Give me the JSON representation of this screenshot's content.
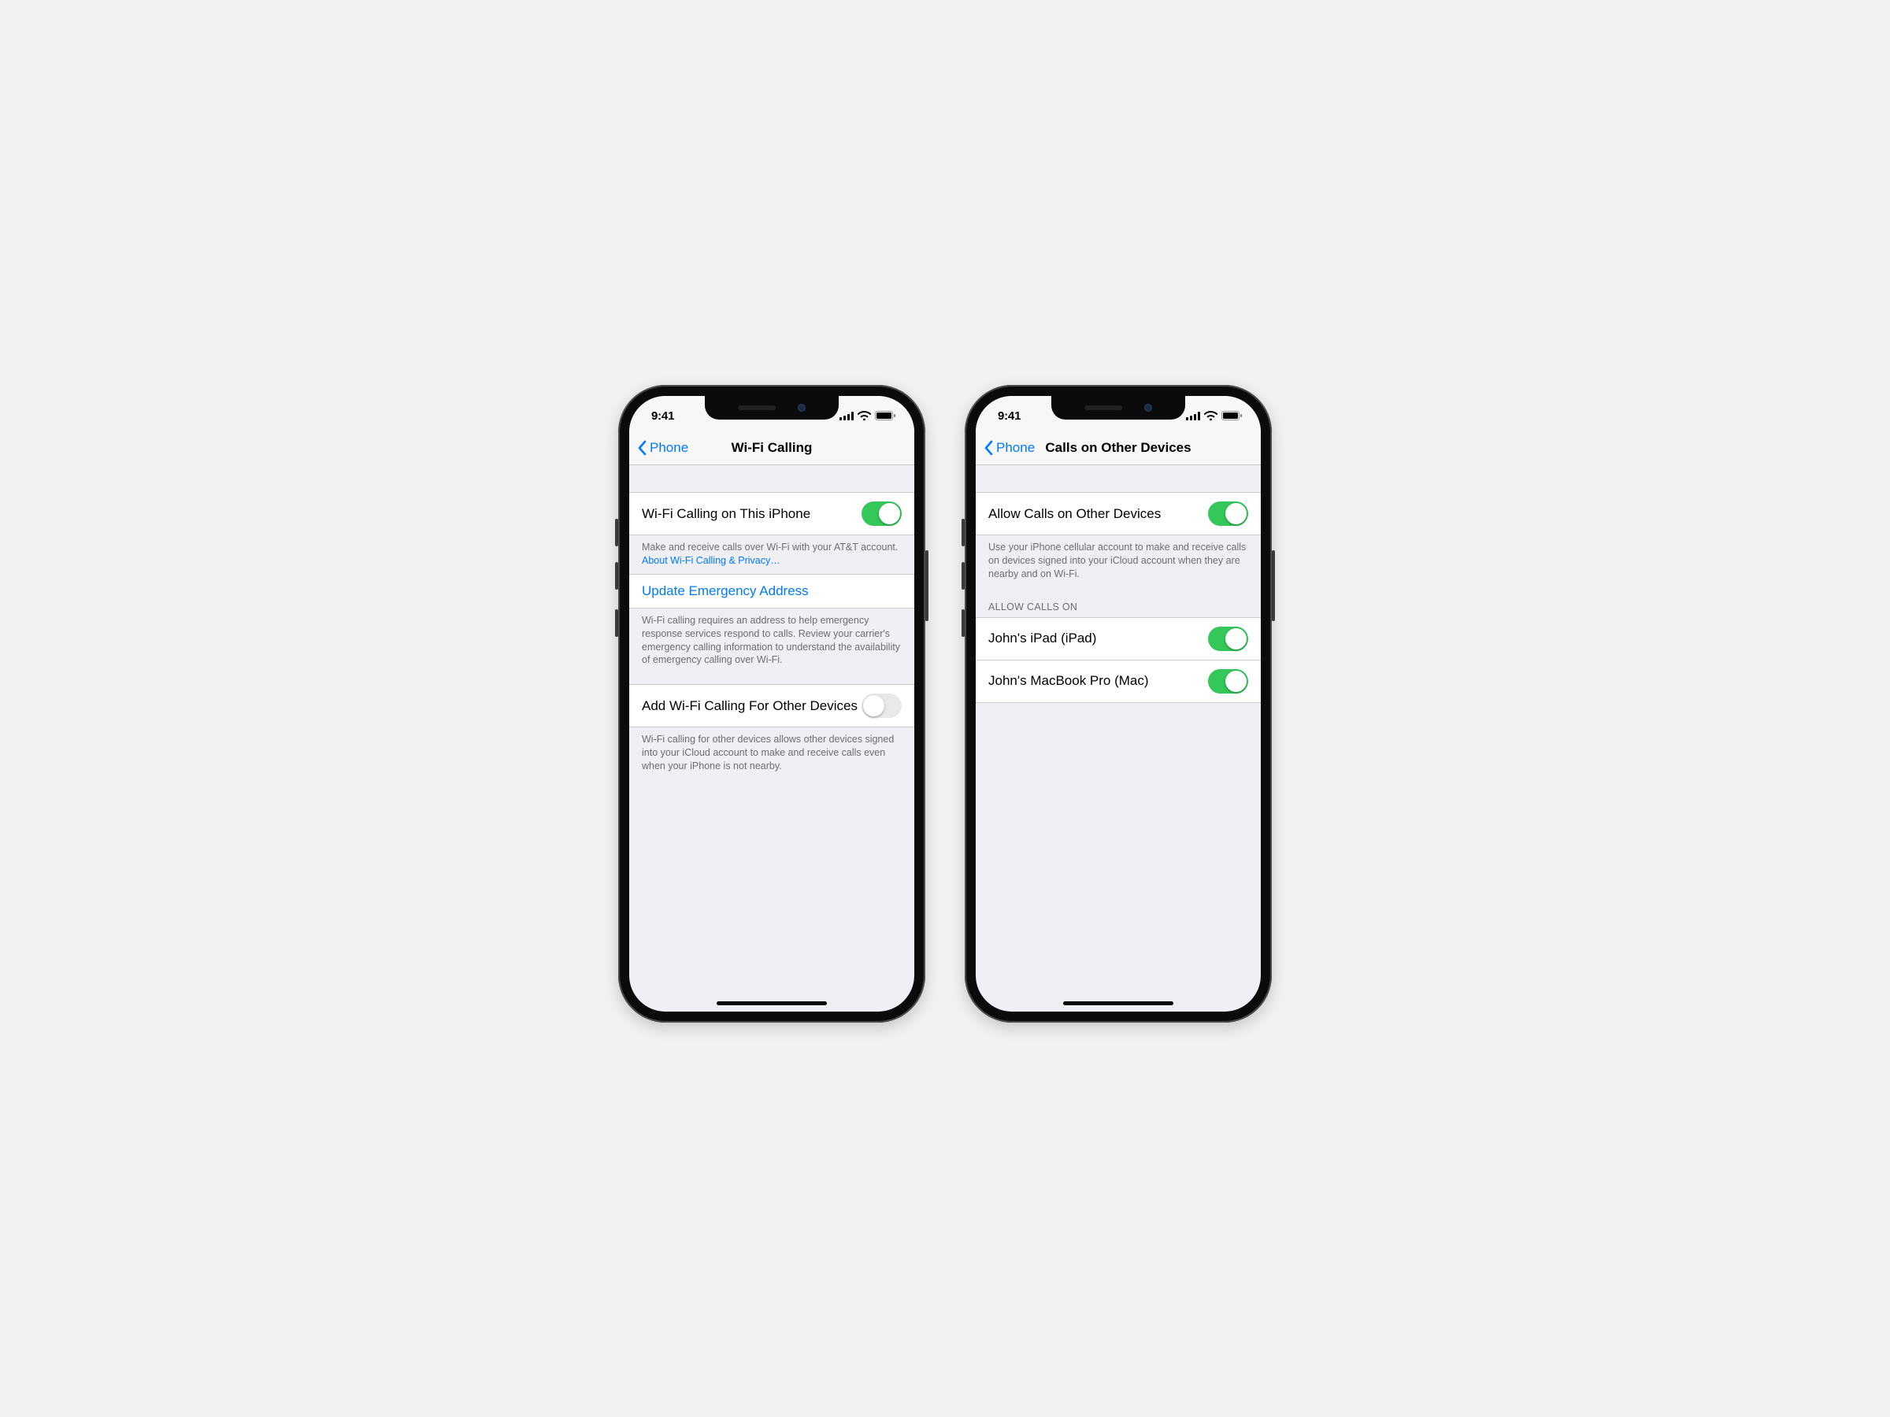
{
  "statusbar": {
    "time": "9:41"
  },
  "phone1": {
    "nav": {
      "back": "Phone",
      "title": "Wi-Fi Calling"
    },
    "row_wifi_on_this_iphone": {
      "label": "Wi-Fi Calling on This iPhone",
      "on": true
    },
    "footer1_text": "Make and receive calls over Wi-Fi with your AT&T account. ",
    "footer1_link": "About Wi-Fi Calling & Privacy…",
    "row_update_emergency": {
      "label": "Update Emergency Address"
    },
    "footer2_text": "Wi-Fi calling requires an address to help emergency response services respond to calls. Review your carrier's emergency calling information to understand the availability of emergency calling over Wi-Fi.",
    "row_add_for_other": {
      "label": "Add Wi-Fi Calling For Other Devices",
      "on": false
    },
    "footer3_text": "Wi-Fi calling for other devices allows other devices signed into your iCloud account to make and receive calls even when your iPhone is not nearby."
  },
  "phone2": {
    "nav": {
      "back": "Phone",
      "title": "Calls on Other Devices"
    },
    "row_allow_calls": {
      "label": "Allow Calls on Other Devices",
      "on": true
    },
    "footer1_text": "Use your iPhone cellular account to make and receive calls on devices signed into your iCloud account when they are nearby and on Wi-Fi.",
    "section_header": "ALLOW CALLS ON",
    "devices": [
      {
        "label": "John's iPad (iPad)",
        "on": true
      },
      {
        "label": "John's MacBook Pro (Mac)",
        "on": true
      }
    ]
  }
}
